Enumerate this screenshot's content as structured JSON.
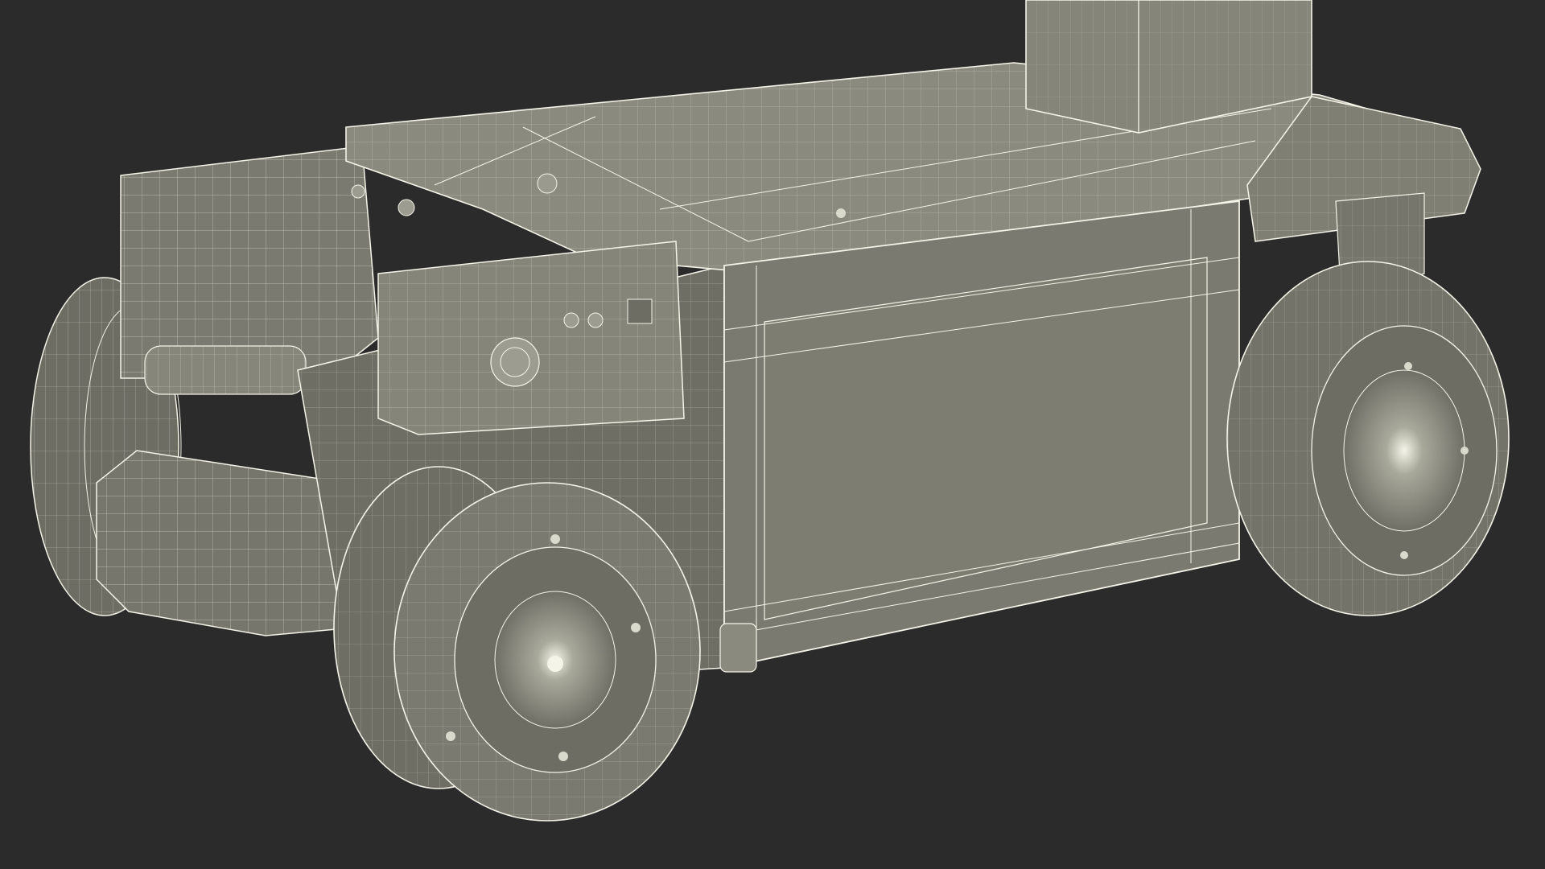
{
  "scene": {
    "subject": "wireframe-vehicle-base",
    "colors": {
      "background": "#2b2b2b",
      "surface": "#7d7d72",
      "surface_light": "#8c8c80",
      "surface_dark": "#5e5e56",
      "shadow": "#474741",
      "wire": "#f4f4e8",
      "wire_dim": "#d9d9cc",
      "hub": "#b4b4a6"
    },
    "parts": [
      "mast-column",
      "top-deck",
      "right-bumper",
      "rear-frame",
      "control-box",
      "side-battery-panel",
      "front-left-wheel",
      "front-right-wheel",
      "rear-left-wheel",
      "rear-caster",
      "fork-tab"
    ]
  }
}
